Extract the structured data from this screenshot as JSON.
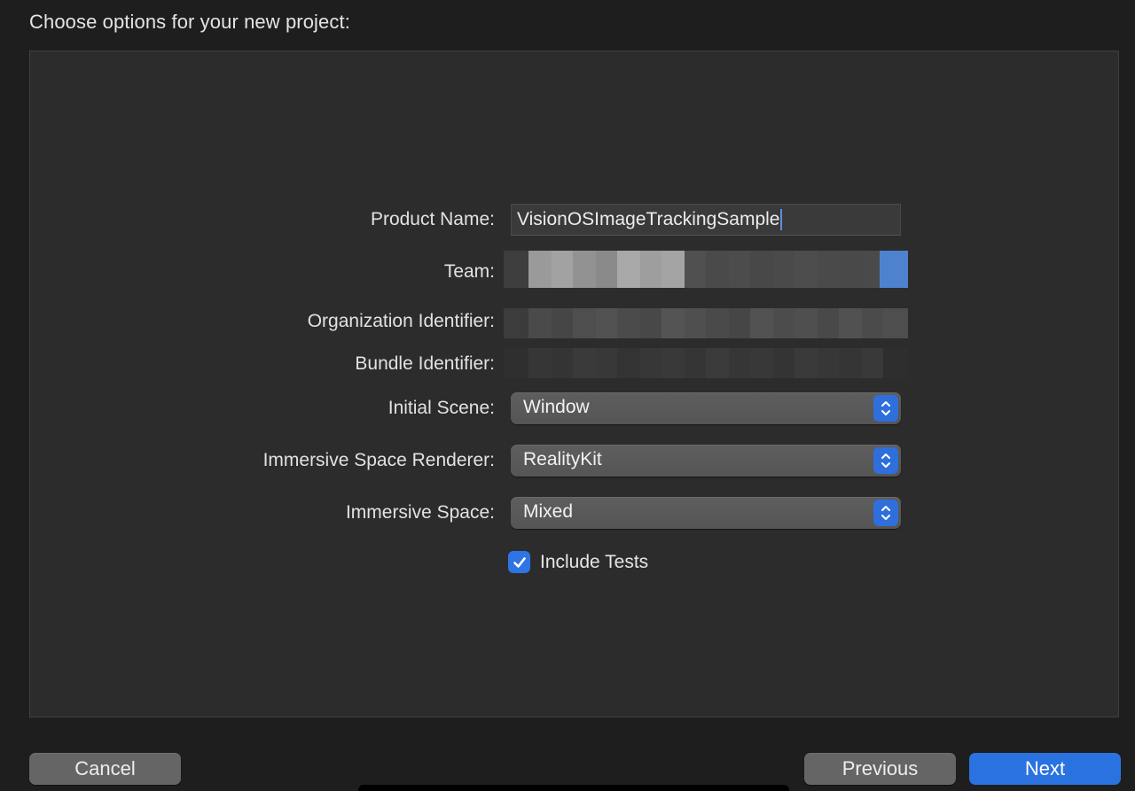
{
  "header": {
    "title": "Choose options for your new project:"
  },
  "form": {
    "product_name_label": "Product Name:",
    "product_name_value": "VisionOSImageTrackingSample",
    "team_label": "Team:",
    "organization_identifier_label": "Organization Identifier:",
    "bundle_identifier_label": "Bundle Identifier:",
    "initial_scene_label": "Initial Scene:",
    "initial_scene_value": "Window",
    "immersive_space_renderer_label": "Immersive Space Renderer:",
    "immersive_space_renderer_value": "RealityKit",
    "immersive_space_label": "Immersive Space:",
    "immersive_space_value": "Mixed",
    "include_tests_label": "Include Tests",
    "include_tests_checked": true
  },
  "footer": {
    "cancel_label": "Cancel",
    "previous_label": "Previous",
    "next_label": "Next"
  },
  "colors": {
    "background": "#1e1e1e",
    "panel": "#2c2c2c",
    "accent": "#2a72e0",
    "popup": "#5a5a5a"
  },
  "icons": {
    "popup_indicator": "chevron-up-down-icon",
    "checkbox": "checkmark-icon"
  }
}
